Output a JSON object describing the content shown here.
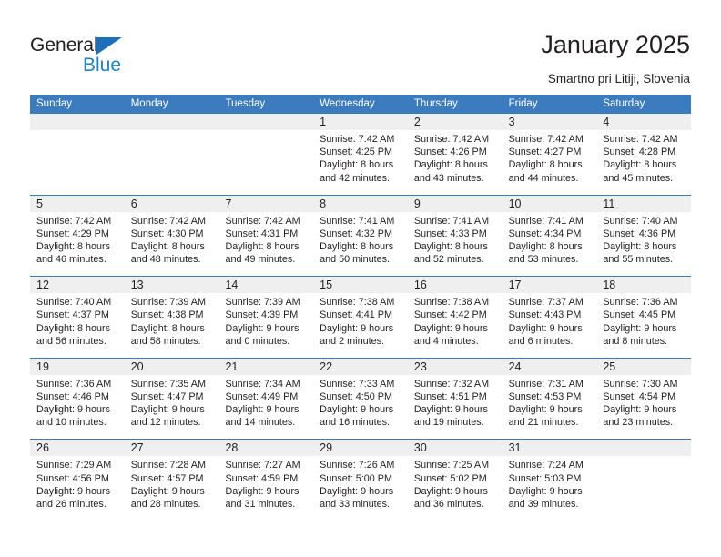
{
  "brand": {
    "name_top": "General",
    "name_bottom": "Blue",
    "triangle_color": "#1e6fba",
    "blue_color": "#1e81c9"
  },
  "header": {
    "title": "January 2025",
    "subtitle": "Smartno pri Litiji, Slovenia"
  },
  "theme": {
    "header_blue": "#3b7cbe",
    "day_band_gray": "#efefef",
    "text": "#231f20"
  },
  "weekdays": [
    "Sunday",
    "Monday",
    "Tuesday",
    "Wednesday",
    "Thursday",
    "Friday",
    "Saturday"
  ],
  "weeks": [
    [
      {
        "empty": true
      },
      {
        "empty": true
      },
      {
        "empty": true
      },
      {
        "day": "1",
        "sunrise": "Sunrise: 7:42 AM",
        "sunset": "Sunset: 4:25 PM",
        "daylight1": "Daylight: 8 hours",
        "daylight2": "and 42 minutes."
      },
      {
        "day": "2",
        "sunrise": "Sunrise: 7:42 AM",
        "sunset": "Sunset: 4:26 PM",
        "daylight1": "Daylight: 8 hours",
        "daylight2": "and 43 minutes."
      },
      {
        "day": "3",
        "sunrise": "Sunrise: 7:42 AM",
        "sunset": "Sunset: 4:27 PM",
        "daylight1": "Daylight: 8 hours",
        "daylight2": "and 44 minutes."
      },
      {
        "day": "4",
        "sunrise": "Sunrise: 7:42 AM",
        "sunset": "Sunset: 4:28 PM",
        "daylight1": "Daylight: 8 hours",
        "daylight2": "and 45 minutes."
      }
    ],
    [
      {
        "day": "5",
        "sunrise": "Sunrise: 7:42 AM",
        "sunset": "Sunset: 4:29 PM",
        "daylight1": "Daylight: 8 hours",
        "daylight2": "and 46 minutes."
      },
      {
        "day": "6",
        "sunrise": "Sunrise: 7:42 AM",
        "sunset": "Sunset: 4:30 PM",
        "daylight1": "Daylight: 8 hours",
        "daylight2": "and 48 minutes."
      },
      {
        "day": "7",
        "sunrise": "Sunrise: 7:42 AM",
        "sunset": "Sunset: 4:31 PM",
        "daylight1": "Daylight: 8 hours",
        "daylight2": "and 49 minutes."
      },
      {
        "day": "8",
        "sunrise": "Sunrise: 7:41 AM",
        "sunset": "Sunset: 4:32 PM",
        "daylight1": "Daylight: 8 hours",
        "daylight2": "and 50 minutes."
      },
      {
        "day": "9",
        "sunrise": "Sunrise: 7:41 AM",
        "sunset": "Sunset: 4:33 PM",
        "daylight1": "Daylight: 8 hours",
        "daylight2": "and 52 minutes."
      },
      {
        "day": "10",
        "sunrise": "Sunrise: 7:41 AM",
        "sunset": "Sunset: 4:34 PM",
        "daylight1": "Daylight: 8 hours",
        "daylight2": "and 53 minutes."
      },
      {
        "day": "11",
        "sunrise": "Sunrise: 7:40 AM",
        "sunset": "Sunset: 4:36 PM",
        "daylight1": "Daylight: 8 hours",
        "daylight2": "and 55 minutes."
      }
    ],
    [
      {
        "day": "12",
        "sunrise": "Sunrise: 7:40 AM",
        "sunset": "Sunset: 4:37 PM",
        "daylight1": "Daylight: 8 hours",
        "daylight2": "and 56 minutes."
      },
      {
        "day": "13",
        "sunrise": "Sunrise: 7:39 AM",
        "sunset": "Sunset: 4:38 PM",
        "daylight1": "Daylight: 8 hours",
        "daylight2": "and 58 minutes."
      },
      {
        "day": "14",
        "sunrise": "Sunrise: 7:39 AM",
        "sunset": "Sunset: 4:39 PM",
        "daylight1": "Daylight: 9 hours",
        "daylight2": "and 0 minutes."
      },
      {
        "day": "15",
        "sunrise": "Sunrise: 7:38 AM",
        "sunset": "Sunset: 4:41 PM",
        "daylight1": "Daylight: 9 hours",
        "daylight2": "and 2 minutes."
      },
      {
        "day": "16",
        "sunrise": "Sunrise: 7:38 AM",
        "sunset": "Sunset: 4:42 PM",
        "daylight1": "Daylight: 9 hours",
        "daylight2": "and 4 minutes."
      },
      {
        "day": "17",
        "sunrise": "Sunrise: 7:37 AM",
        "sunset": "Sunset: 4:43 PM",
        "daylight1": "Daylight: 9 hours",
        "daylight2": "and 6 minutes."
      },
      {
        "day": "18",
        "sunrise": "Sunrise: 7:36 AM",
        "sunset": "Sunset: 4:45 PM",
        "daylight1": "Daylight: 9 hours",
        "daylight2": "and 8 minutes."
      }
    ],
    [
      {
        "day": "19",
        "sunrise": "Sunrise: 7:36 AM",
        "sunset": "Sunset: 4:46 PM",
        "daylight1": "Daylight: 9 hours",
        "daylight2": "and 10 minutes."
      },
      {
        "day": "20",
        "sunrise": "Sunrise: 7:35 AM",
        "sunset": "Sunset: 4:47 PM",
        "daylight1": "Daylight: 9 hours",
        "daylight2": "and 12 minutes."
      },
      {
        "day": "21",
        "sunrise": "Sunrise: 7:34 AM",
        "sunset": "Sunset: 4:49 PM",
        "daylight1": "Daylight: 9 hours",
        "daylight2": "and 14 minutes."
      },
      {
        "day": "22",
        "sunrise": "Sunrise: 7:33 AM",
        "sunset": "Sunset: 4:50 PM",
        "daylight1": "Daylight: 9 hours",
        "daylight2": "and 16 minutes."
      },
      {
        "day": "23",
        "sunrise": "Sunrise: 7:32 AM",
        "sunset": "Sunset: 4:51 PM",
        "daylight1": "Daylight: 9 hours",
        "daylight2": "and 19 minutes."
      },
      {
        "day": "24",
        "sunrise": "Sunrise: 7:31 AM",
        "sunset": "Sunset: 4:53 PM",
        "daylight1": "Daylight: 9 hours",
        "daylight2": "and 21 minutes."
      },
      {
        "day": "25",
        "sunrise": "Sunrise: 7:30 AM",
        "sunset": "Sunset: 4:54 PM",
        "daylight1": "Daylight: 9 hours",
        "daylight2": "and 23 minutes."
      }
    ],
    [
      {
        "day": "26",
        "sunrise": "Sunrise: 7:29 AM",
        "sunset": "Sunset: 4:56 PM",
        "daylight1": "Daylight: 9 hours",
        "daylight2": "and 26 minutes."
      },
      {
        "day": "27",
        "sunrise": "Sunrise: 7:28 AM",
        "sunset": "Sunset: 4:57 PM",
        "daylight1": "Daylight: 9 hours",
        "daylight2": "and 28 minutes."
      },
      {
        "day": "28",
        "sunrise": "Sunrise: 7:27 AM",
        "sunset": "Sunset: 4:59 PM",
        "daylight1": "Daylight: 9 hours",
        "daylight2": "and 31 minutes."
      },
      {
        "day": "29",
        "sunrise": "Sunrise: 7:26 AM",
        "sunset": "Sunset: 5:00 PM",
        "daylight1": "Daylight: 9 hours",
        "daylight2": "and 33 minutes."
      },
      {
        "day": "30",
        "sunrise": "Sunrise: 7:25 AM",
        "sunset": "Sunset: 5:02 PM",
        "daylight1": "Daylight: 9 hours",
        "daylight2": "and 36 minutes."
      },
      {
        "day": "31",
        "sunrise": "Sunrise: 7:24 AM",
        "sunset": "Sunset: 5:03 PM",
        "daylight1": "Daylight: 9 hours",
        "daylight2": "and 39 minutes."
      },
      {
        "empty": true
      }
    ]
  ]
}
